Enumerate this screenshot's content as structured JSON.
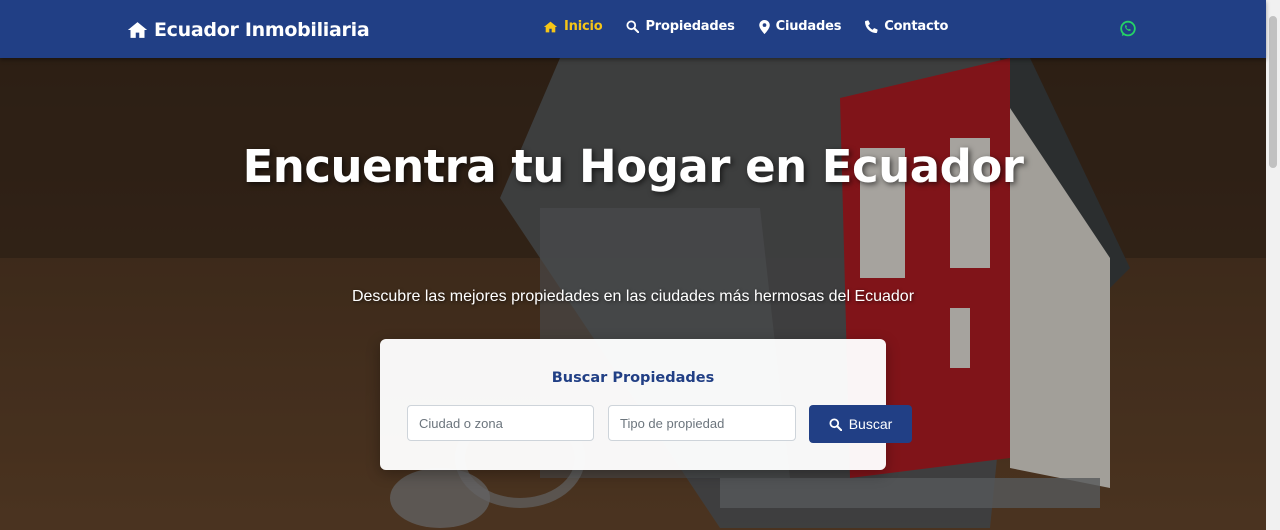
{
  "navbar": {
    "brand": "Ecuador Inmobiliaria",
    "brand_icon": "home-icon",
    "links": [
      {
        "label": "Inicio",
        "icon": "home-icon",
        "active": true
      },
      {
        "label": "Propiedades",
        "icon": "search-icon",
        "active": false
      },
      {
        "label": "Ciudades",
        "icon": "map-marker-icon",
        "active": false
      },
      {
        "label": "Contacto",
        "icon": "phone-icon",
        "active": false
      }
    ],
    "whatsapp_icon": "whatsapp-icon"
  },
  "hero": {
    "title": "Encuentra tu Hogar en Ecuador",
    "subtitle": "Descubre las mejores propiedades en las ciudades más hermosas del Ecuador"
  },
  "search": {
    "title": "Buscar Propiedades",
    "city_placeholder": "Ciudad o zona",
    "type_placeholder": "Tipo de propiedad",
    "button_label": "Buscar"
  },
  "colors": {
    "primary": "#213f85",
    "active_link": "#f5c518",
    "whatsapp": "#25d366"
  }
}
